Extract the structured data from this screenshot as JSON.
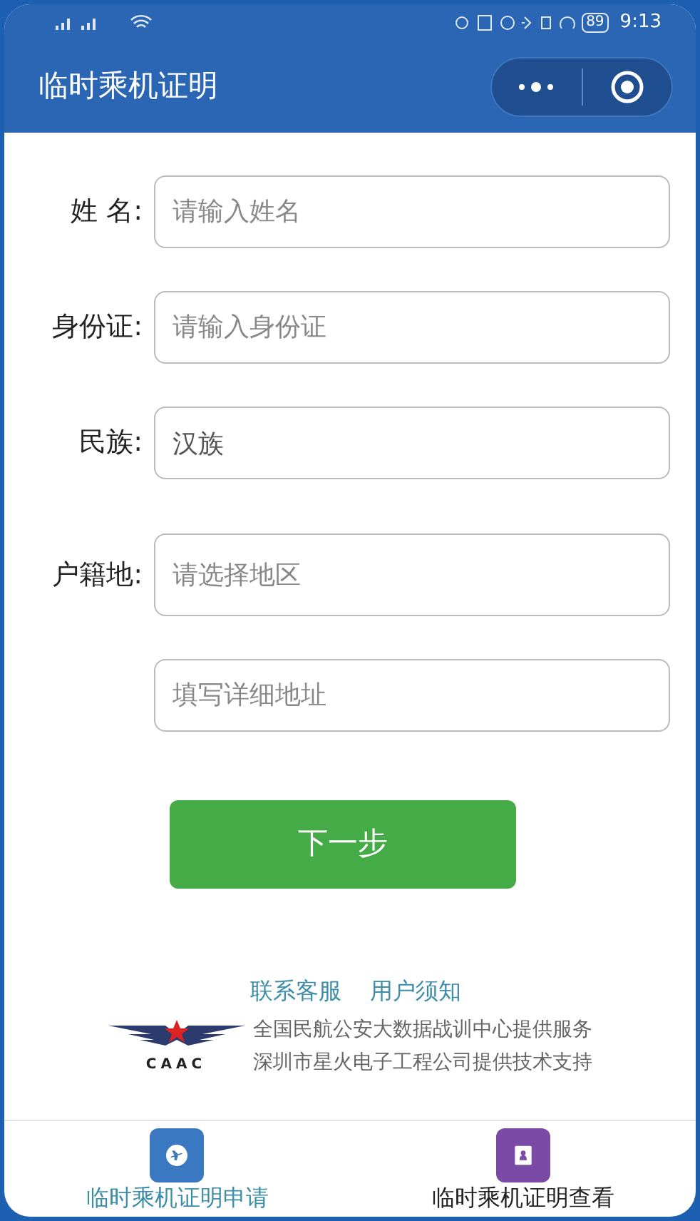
{
  "status_bar": {
    "battery": "89",
    "time": "9:13"
  },
  "header": {
    "title": "临时乘机证明"
  },
  "form": {
    "fields": [
      {
        "label": "姓 名:",
        "placeholder": "请输入姓名"
      },
      {
        "label": "身份证:",
        "placeholder": "请输入身份证"
      },
      {
        "label": "民族:",
        "value": "汉族"
      },
      {
        "label": "户籍地:",
        "placeholder": "请选择地区"
      },
      {
        "placeholder": "填写详细地址"
      }
    ],
    "submit": "下一步"
  },
  "links": [
    "联系客服",
    "用户须知"
  ],
  "footer": {
    "logo_text": "CAAC",
    "lines": [
      "全国民航公安大数据战训中心提供服务",
      "深圳市星火电子工程公司提供技术支持"
    ]
  },
  "tabs": [
    {
      "label": "临时乘机证明申请",
      "selected": true,
      "kind": "plane",
      "color": "#3a78c2"
    },
    {
      "label": "临时乘机证明查看",
      "selected": false,
      "kind": "certificate",
      "color": "#7b4aa6"
    }
  ]
}
